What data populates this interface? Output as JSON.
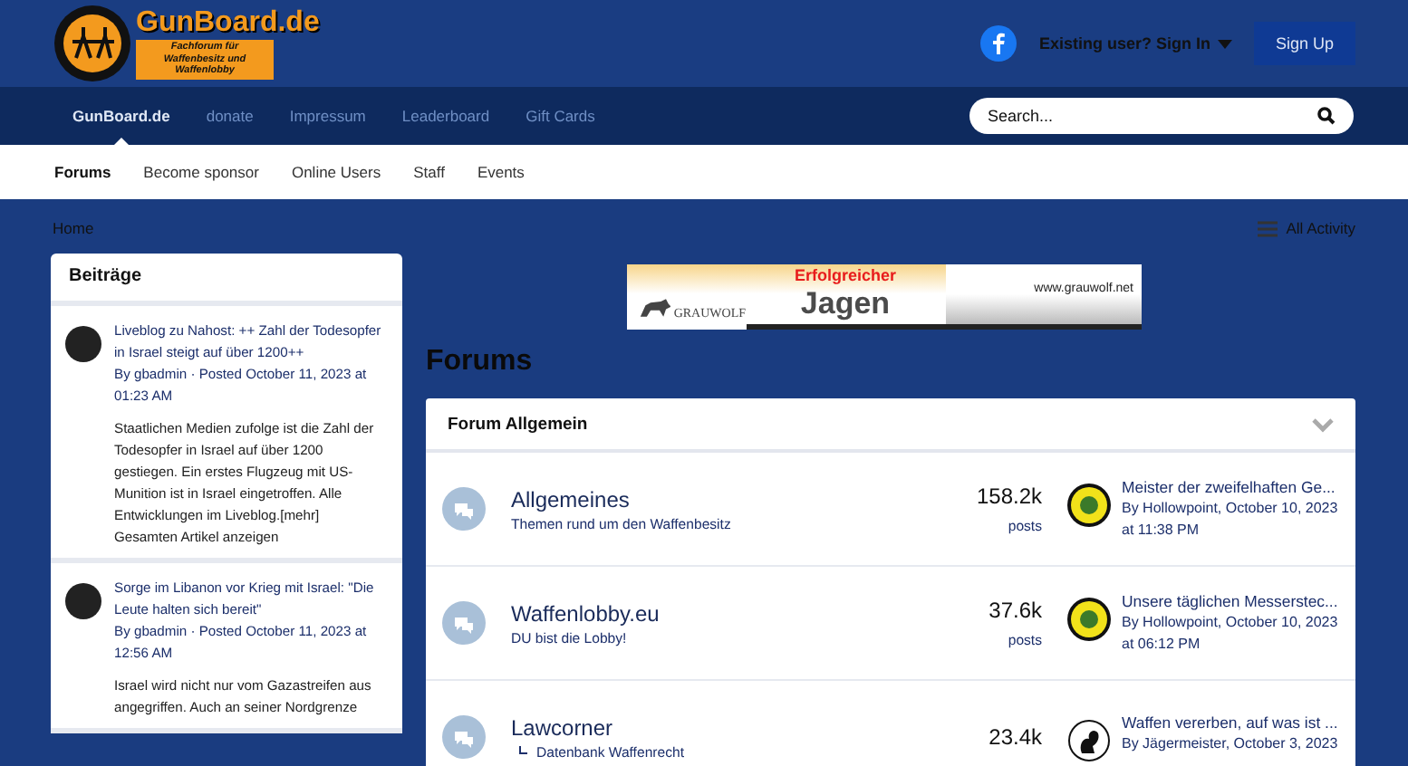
{
  "header": {
    "logo_title": "GunBoard.de",
    "logo_subtitle": "Fachforum für Waffenbesitz und Waffenlobby",
    "sign_in": "Existing user? Sign In",
    "sign_up": "Sign Up"
  },
  "nav": [
    {
      "label": "GunBoard.de",
      "selected": true
    },
    {
      "label": "donate",
      "selected": false
    },
    {
      "label": "Impressum",
      "selected": false
    },
    {
      "label": "Leaderboard",
      "selected": false
    },
    {
      "label": "Gift Cards",
      "selected": false
    }
  ],
  "search": {
    "placeholder": "Search..."
  },
  "subnav": [
    {
      "label": "Forums",
      "selected": true
    },
    {
      "label": "Become sponsor",
      "selected": false
    },
    {
      "label": "Online Users",
      "selected": false
    },
    {
      "label": "Staff",
      "selected": false
    },
    {
      "label": "Events",
      "selected": false
    }
  ],
  "breadcrumb": "Home",
  "all_activity": "All Activity",
  "sidebar": {
    "title": "Beiträge",
    "posts": [
      {
        "title": "Liveblog zu Nahost: ++ Zahl der Todesopfer in Israel steigt auf über 1200++",
        "meta": "By gbadmin · Posted October 11, 2023 at 01:23 AM",
        "body": "Staatlichen Medien zufolge ist die Zahl der Todesopfer in Israel auf über 1200 gestiegen. Ein erstes Flugzeug mit US-Munition ist in Israel eingetroffen. Alle Entwicklungen im Liveblog.[mehr]",
        "more": "Gesamten Artikel anzeigen"
      },
      {
        "title": "Sorge im Libanon vor Krieg mit Israel: \"Die Leute halten sich bereit\"",
        "meta": "By gbadmin · Posted October 11, 2023 at 12:56 AM",
        "body": "Israel wird nicht nur vom Gazastreifen aus angegriffen. Auch an seiner Nordgrenze"
      }
    ]
  },
  "banner": {
    "brand": "GRAUWOLF",
    "headline": "Erfolgreicher",
    "word": "Jagen",
    "url": "www.grauwolf.net"
  },
  "forums_title": "Forums",
  "category": {
    "title": "Forum Allgemein",
    "expanded": true,
    "forums": [
      {
        "name": "Allgemeines",
        "desc": "Themen rund um den Waffenbesitz",
        "count": "158.2k",
        "unit": "posts",
        "last_title": "Meister der zweifelhaften Ge...",
        "last_meta": "By Hollowpoint, October 10, 2023 at 11:38 PM",
        "kind": "badge"
      },
      {
        "name": "Waffenlobby.eu",
        "desc": "DU bist die Lobby!",
        "count": "37.6k",
        "unit": "posts",
        "last_title": "Unsere täglichen Messerstec...",
        "last_meta": "By Hollowpoint, October 10, 2023 at 06:12 PM",
        "kind": "badge"
      },
      {
        "name": "Lawcorner",
        "subforum": "Datenbank Waffenrecht",
        "count": "23.4k",
        "last_title": "Waffen vererben, auf was ist ...",
        "last_meta": "By Jägermeister, October 3, 2023",
        "kind": "squirrel"
      }
    ]
  }
}
